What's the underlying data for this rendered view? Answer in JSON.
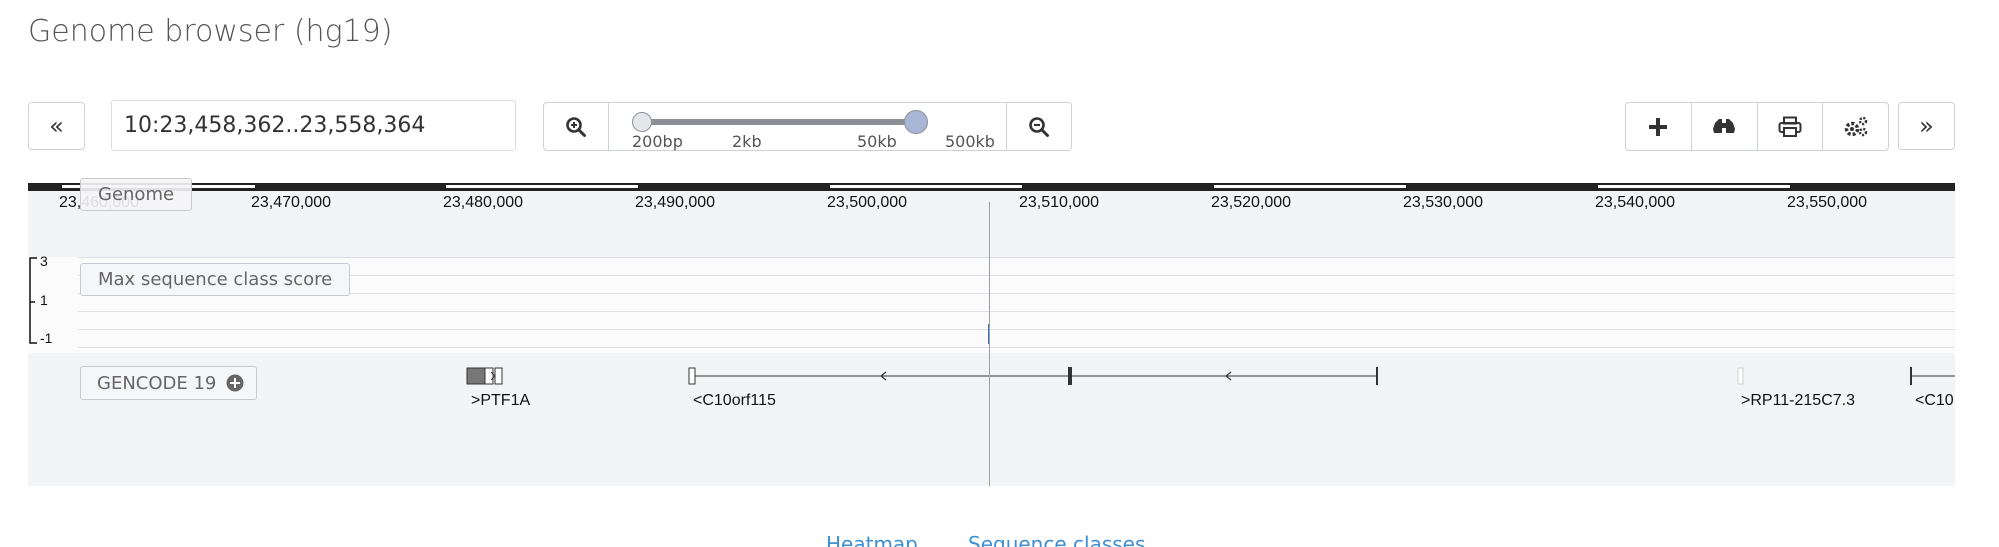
{
  "page": {
    "title": "Genome browser (hg19)"
  },
  "toolbar": {
    "prev_label": "«",
    "next_label": "»",
    "locus_value": "10:23,458,362..23,558,364",
    "zoom_ticks": [
      "200bp",
      "2kb",
      "50kb",
      "500kb"
    ],
    "tools": [
      "add-track-icon",
      "binoculars-icon",
      "print-icon",
      "settings-icon"
    ]
  },
  "ruler": {
    "coords": [
      "23,460,000",
      "23,470,000",
      "23,480,000",
      "23,490,000",
      "23,500,000",
      "23,510,000",
      "23,520,000",
      "23,530,000",
      "23,540,000",
      "23,550,000"
    ]
  },
  "tracks": {
    "genome_label": "Genome",
    "score_label": "Max sequence class score",
    "score_axis": [
      "3",
      "1",
      "-1"
    ],
    "gencode_label": "GENCODE 19",
    "genes": [
      ">PTF1A",
      "<C10orf115",
      ">RP11-215C7.3",
      "<C10"
    ]
  },
  "tabs": [
    "Heatmap",
    "Sequence classes"
  ],
  "colors": {
    "link": "#3d8fd1",
    "panel_bg": "#f3f4f6",
    "handle": "#a9b7d6"
  }
}
